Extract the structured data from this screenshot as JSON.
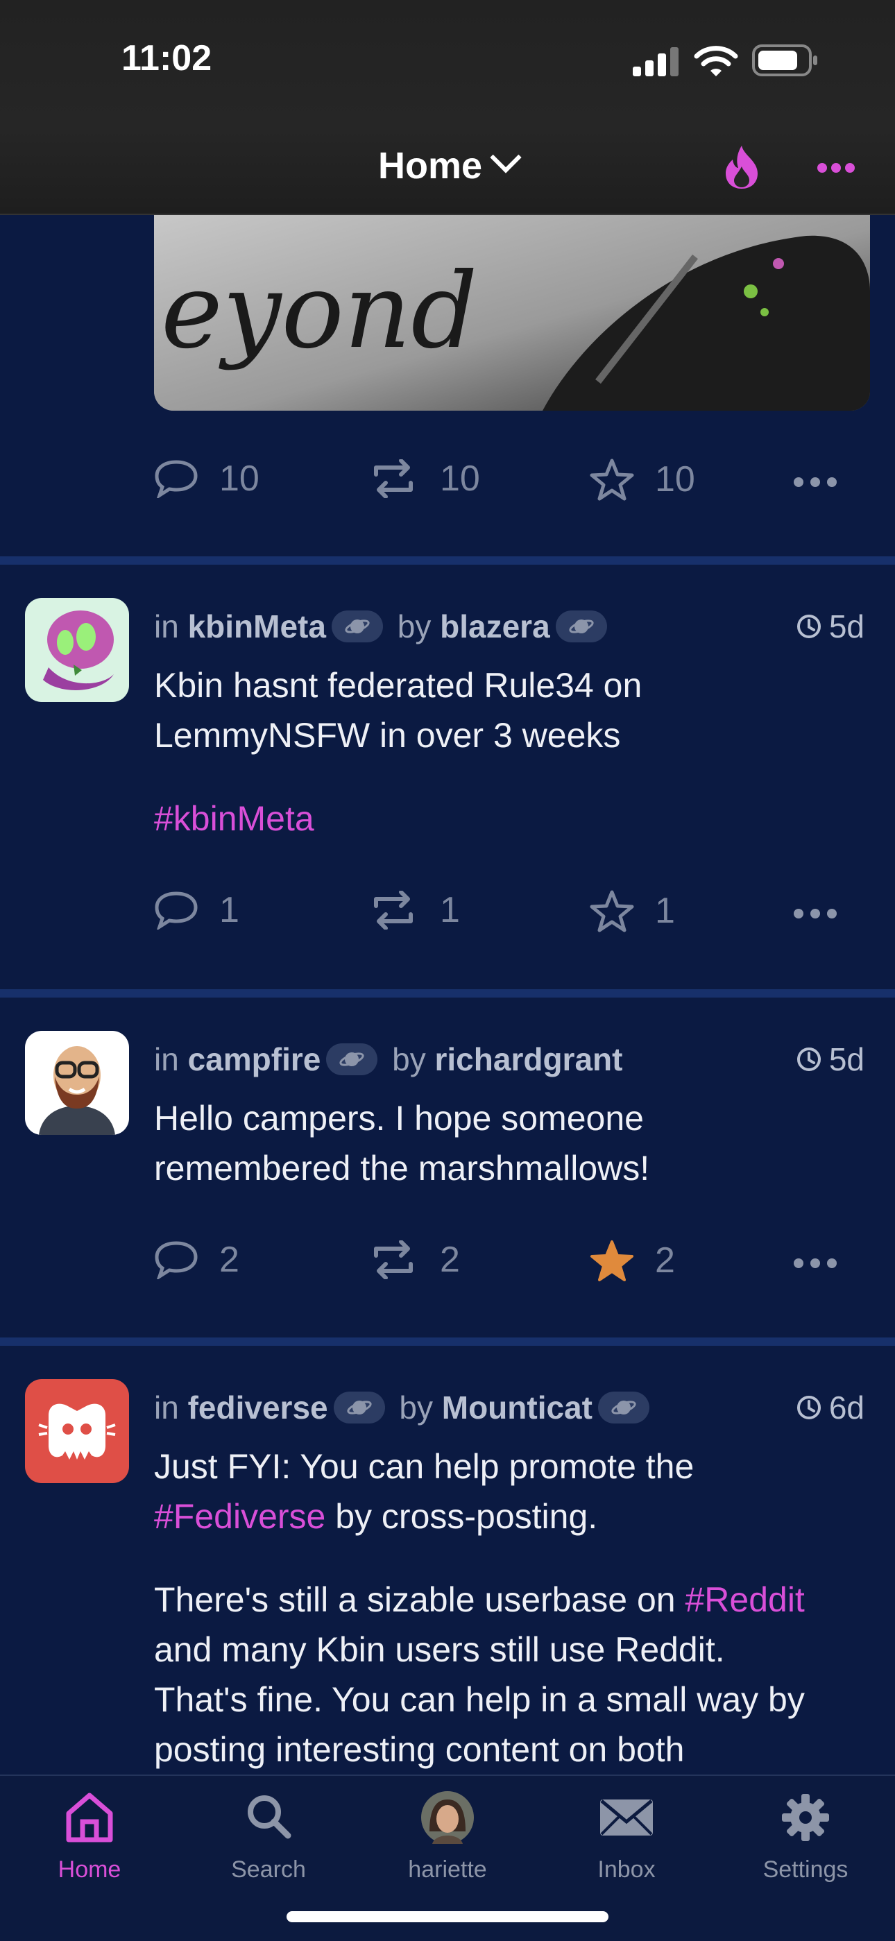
{
  "status_bar": {
    "time": "11:02"
  },
  "nav": {
    "title": "Home"
  },
  "colors": {
    "accent": "#d94fd8",
    "background": "#0b1a42",
    "star_active": "#e08a3c"
  },
  "prev_post": {
    "image_text": "eyond",
    "comments": "10",
    "boosts": "10",
    "favorites": "10"
  },
  "posts": [
    {
      "prefix_in": "in",
      "magazine": "kbinMeta",
      "prefix_by": "by",
      "author": "blazera",
      "age": "5d",
      "line1": "Kbin hasnt federated Rule34 on",
      "line2": "LemmyNSFW in over 3 weeks",
      "hashtag": "#kbinMeta",
      "comments": "1",
      "boosts": "1",
      "favorites": "1"
    },
    {
      "prefix_in": "in",
      "magazine": "campfire",
      "prefix_by": "by",
      "author": "richardgrant",
      "age": "5d",
      "line1": "Hello campers. I hope someone",
      "line2": "remembered the marshmallows!",
      "comments": "2",
      "boosts": "2",
      "favorites": "2"
    },
    {
      "prefix_in": "in",
      "magazine": "fediverse",
      "prefix_by": "by",
      "author": "Mounticat",
      "age": "6d",
      "line1": "Just FYI: You can help promote the",
      "line2_tag": "#Fediverse",
      "line2_rest": " by cross-posting.",
      "p2_line1_text": "There's still a sizable userbase on ",
      "p2_line1_tag": "#Reddit",
      "p2_line2": "and many Kbin users still use Reddit.",
      "p2_line3": "That's fine. You can help in a small way by",
      "p2_line4": "posting interesting content on both"
    }
  ],
  "tabs": [
    {
      "label": "Home",
      "icon": "home-icon",
      "active": true
    },
    {
      "label": "Search",
      "icon": "search-icon"
    },
    {
      "label": "hariette",
      "icon": "avatar"
    },
    {
      "label": "Inbox",
      "icon": "envelope-icon"
    },
    {
      "label": "Settings",
      "icon": "gear-icon"
    }
  ]
}
